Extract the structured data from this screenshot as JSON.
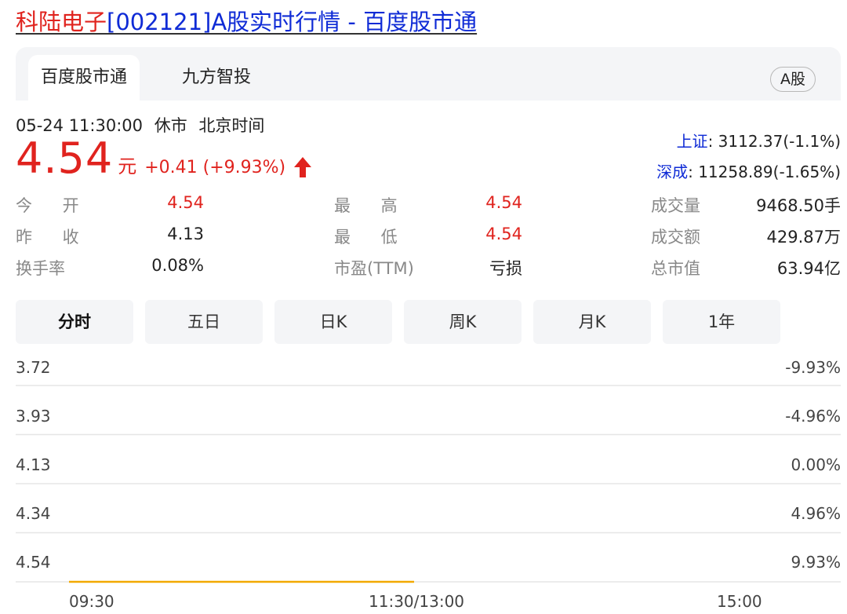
{
  "page_title": {
    "highlight": "科陆电子",
    "rest": "[002121]A股实时行情 - 百度股市通"
  },
  "tabs": [
    {
      "label": "百度股市通",
      "active": true
    },
    {
      "label": "九方智投",
      "active": false
    }
  ],
  "market_badge": "A股",
  "status": {
    "datetime": "05-24 11:30:00",
    "state": "休市",
    "timezone": "北京时间"
  },
  "quote": {
    "price": "4.54",
    "unit": "元",
    "change": "+0.41 (+9.93%)",
    "direction_icon": "arrow-up-icon"
  },
  "indices": [
    {
      "name": "上证",
      "value": ": 3112.37(-1.1%)"
    },
    {
      "name": "深成",
      "value": ": 11258.89(-1.65%)"
    }
  ],
  "stats": [
    [
      {
        "label": "今 开",
        "value": "4.54",
        "color": "red"
      },
      {
        "label": "最 高",
        "value": "4.54",
        "color": "red"
      },
      {
        "label": "成交量",
        "value": "9468.50手",
        "color": "dark"
      }
    ],
    [
      {
        "label": "昨 收",
        "value": "4.13",
        "color": "dark"
      },
      {
        "label": "最 低",
        "value": "4.54",
        "color": "red"
      },
      {
        "label": "成交额",
        "value": "429.87万",
        "color": "dark"
      }
    ],
    [
      {
        "label": "换手率",
        "value": "0.08%",
        "color": "dark"
      },
      {
        "label": "市盈(TTM)",
        "value": "亏损",
        "color": "dark"
      },
      {
        "label": "总市值",
        "value": "63.94亿",
        "color": "dark"
      }
    ]
  ],
  "period_tabs": [
    {
      "label": "分时",
      "active": true
    },
    {
      "label": "五日",
      "active": false
    },
    {
      "label": "日K",
      "active": false
    },
    {
      "label": "周K",
      "active": false
    },
    {
      "label": "月K",
      "active": false
    },
    {
      "label": "1年",
      "active": false
    }
  ],
  "chart_data": {
    "type": "line",
    "y_prices": [
      "3.72",
      "3.93",
      "4.13",
      "4.34",
      "4.54"
    ],
    "y_percents": [
      "-9.93%",
      "-4.96%",
      "0.00%",
      "4.96%",
      "9.93%"
    ],
    "x_labels": [
      "09:30",
      "11:30/13:00",
      "15:00"
    ],
    "ylim": [
      3.72,
      4.54
    ],
    "series": [
      {
        "values": [
          4.54,
          4.54
        ]
      }
    ],
    "series_x_fraction": [
      0.0,
      0.5
    ],
    "line_color": "#f2a900",
    "grid": true
  },
  "colors": {
    "up": "#e0231e",
    "link": "#0f2bd6",
    "tab_bg": "#f4f5f7"
  }
}
